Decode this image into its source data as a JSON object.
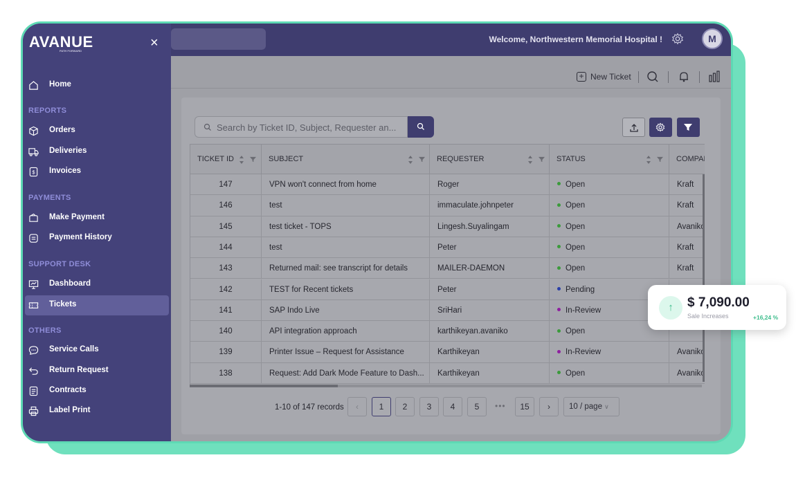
{
  "app": {
    "logo": "AVANUE",
    "logo_tagline": "PATH FORWARD"
  },
  "topbar": {
    "welcome": "Welcome, Northwestern Memorial Hospital !",
    "avatar_initial": "M"
  },
  "subbar": {
    "new_ticket_label": "New Ticket"
  },
  "sidebar": {
    "items": [
      {
        "label": "Home",
        "icon": "home-icon"
      },
      {
        "label": "Orders",
        "icon": "box-icon"
      },
      {
        "label": "Deliveries",
        "icon": "truck-icon"
      },
      {
        "label": "Invoices",
        "icon": "invoice-icon"
      },
      {
        "label": "Make Payment",
        "icon": "wallet-icon"
      },
      {
        "label": "Payment History",
        "icon": "history-icon"
      },
      {
        "label": "Dashboard",
        "icon": "presentation-icon"
      },
      {
        "label": "Tickets",
        "icon": "ticket-icon"
      },
      {
        "label": "Service Calls",
        "icon": "chat-icon"
      },
      {
        "label": "Return Request",
        "icon": "return-icon"
      },
      {
        "label": "Contracts",
        "icon": "contract-icon"
      },
      {
        "label": "Label Print",
        "icon": "printer-icon"
      }
    ],
    "sections": {
      "reports": "REPORTS",
      "payments": "PAYMENTS",
      "support": "SUPPORT DESK",
      "others": "OTHERS"
    },
    "active_item": "Tickets"
  },
  "search": {
    "placeholder": "Search by Ticket ID, Subject, Requester an..."
  },
  "table": {
    "columns": [
      "TICKET ID",
      "SUBJECT",
      "REQUESTER",
      "STATUS",
      "COMPAN"
    ],
    "rows": [
      {
        "id": "147",
        "subject": "VPN won't connect from home",
        "requester": "Roger",
        "status": "Open",
        "company": "Kraft"
      },
      {
        "id": "146",
        "subject": "test",
        "requester": "immaculate.johnpeter",
        "status": "Open",
        "company": "Kraft"
      },
      {
        "id": "145",
        "subject": "test ticket - TOPS",
        "requester": "Lingesh.Suyalingam",
        "status": "Open",
        "company": "Avanikc"
      },
      {
        "id": "144",
        "subject": "test",
        "requester": "Peter",
        "status": "Open",
        "company": "Kraft"
      },
      {
        "id": "143",
        "subject": "Returned mail: see transcript for details",
        "requester": "MAILER-DAEMON",
        "status": "Open",
        "company": "Kraft"
      },
      {
        "id": "142",
        "subject": "TEST for Recent tickets",
        "requester": "Peter",
        "status": "Pending",
        "company": ""
      },
      {
        "id": "141",
        "subject": "SAP Indo Live",
        "requester": "SriHari",
        "status": "In-Review",
        "company": ""
      },
      {
        "id": "140",
        "subject": "API integration approach",
        "requester": "karthikeyan.avaniko",
        "status": "Open",
        "company": ""
      },
      {
        "id": "139",
        "subject": "Printer Issue – Request for Assistance",
        "requester": "Karthikeyan",
        "status": "In-Review",
        "company": "Avanikc"
      },
      {
        "id": "138",
        "subject": "Request: Add Dark Mode Feature to Dash...",
        "requester": "Karthikeyan",
        "status": "Open",
        "company": "Avanikc"
      }
    ],
    "status_colors": {
      "Open": "#3b9a3b",
      "Pending": "#2a3fa8",
      "In-Review": "#8e1fa0"
    }
  },
  "pagination": {
    "records": "1-10 of 147 records",
    "pages": [
      "1",
      "2",
      "3",
      "4",
      "5",
      "15"
    ],
    "current": "1",
    "ellipsis": "•••",
    "per_page": "10 / page"
  },
  "card": {
    "amount": "$ 7,090.00",
    "label": "Sale Increases",
    "pct": "+16,24 %"
  },
  "colors": {
    "navy": "#44427a",
    "accent_green": "#6fe0bd",
    "active_nav": "#615f9a"
  }
}
